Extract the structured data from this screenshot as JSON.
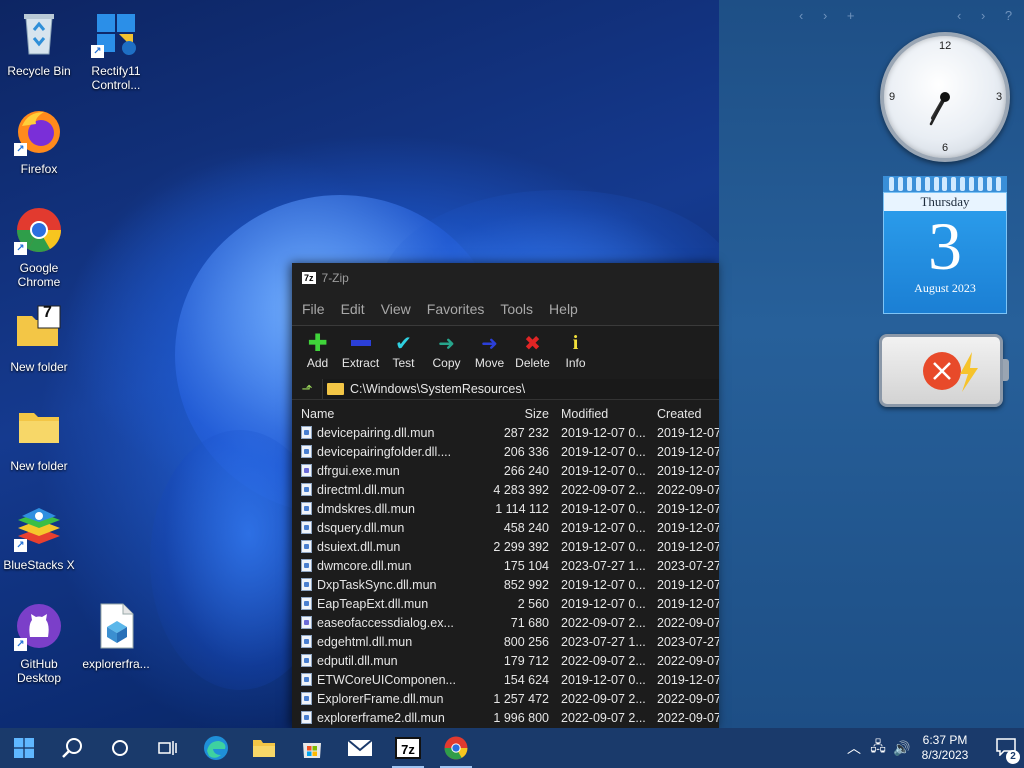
{
  "desktop": {
    "icons": [
      {
        "label": "Recycle Bin",
        "icon": "recycle-bin-icon"
      },
      {
        "label": "Rectify11 Control...",
        "icon": "rectify11-control-icon"
      },
      {
        "label": "Firefox",
        "icon": "firefox-icon"
      },
      {
        "label": "Google Chrome",
        "icon": "chrome-icon"
      },
      {
        "label": "New folder",
        "icon": "folder-7zip-icon",
        "badge": "7"
      },
      {
        "label": "New folder",
        "icon": "folder-icon"
      },
      {
        "label": "BlueStacks X",
        "icon": "bluestacks-icon"
      },
      {
        "label": "GitHub Desktop",
        "icon": "github-desktop-icon"
      },
      {
        "label": "explorerfra...",
        "icon": "dll-file-icon"
      }
    ]
  },
  "gadgets": {
    "clock": {
      "numbers": [
        "12",
        "3",
        "6",
        "9"
      ]
    },
    "calendar": {
      "weekday": "Thursday",
      "day": "3",
      "month_year": "August 2023"
    },
    "battery": {
      "status_icon": "battery-error-icon"
    }
  },
  "zip": {
    "title": "7-Zip",
    "logo": "7z",
    "menu": [
      "File",
      "Edit",
      "View",
      "Favorites",
      "Tools",
      "Help"
    ],
    "toolbar": [
      {
        "label": "Add",
        "icon": "add-icon",
        "glyph": "✚",
        "color": "#3fd43a"
      },
      {
        "label": "Extract",
        "icon": "extract-icon",
        "glyph": "▬",
        "color": "#2b3fd8"
      },
      {
        "label": "Test",
        "icon": "test-icon",
        "glyph": "✔",
        "color": "#2fd0e0"
      },
      {
        "label": "Copy",
        "icon": "copy-icon",
        "glyph": "➜",
        "color": "#27a58c"
      },
      {
        "label": "Move",
        "icon": "move-icon",
        "glyph": "➜",
        "color": "#2b3fd8"
      },
      {
        "label": "Delete",
        "icon": "delete-icon",
        "glyph": "✖",
        "color": "#e02525"
      },
      {
        "label": "Info",
        "icon": "info-icon",
        "glyph": "i",
        "color": "#f2e03a"
      }
    ],
    "path": "C:\\Windows\\SystemResources\\",
    "columns": {
      "name": "Name",
      "size": "Size",
      "modified": "Modified",
      "created": "Created"
    },
    "files": [
      {
        "name": "devicepairing.dll.mun",
        "size": "287 232",
        "modified": "2019-12-07 0...",
        "created": "2019-12-07"
      },
      {
        "name": "devicepairingfolder.dll....",
        "size": "206 336",
        "modified": "2019-12-07 0...",
        "created": "2019-12-07"
      },
      {
        "name": "dfrgui.exe.mun",
        "size": "266 240",
        "modified": "2019-12-07 0...",
        "created": "2019-12-07",
        "type": "exe"
      },
      {
        "name": "directml.dll.mun",
        "size": "4 283 392",
        "modified": "2022-09-07 2...",
        "created": "2022-09-07"
      },
      {
        "name": "dmdskres.dll.mun",
        "size": "1 114 112",
        "modified": "2019-12-07 0...",
        "created": "2019-12-07"
      },
      {
        "name": "dsquery.dll.mun",
        "size": "458 240",
        "modified": "2019-12-07 0...",
        "created": "2019-12-07"
      },
      {
        "name": "dsuiext.dll.mun",
        "size": "2 299 392",
        "modified": "2019-12-07 0...",
        "created": "2019-12-07"
      },
      {
        "name": "dwmcore.dll.mun",
        "size": "175 104",
        "modified": "2023-07-27 1...",
        "created": "2023-07-27"
      },
      {
        "name": "DxpTaskSync.dll.mun",
        "size": "852 992",
        "modified": "2019-12-07 0...",
        "created": "2019-12-07"
      },
      {
        "name": "EapTeapExt.dll.mun",
        "size": "2 560",
        "modified": "2019-12-07 0...",
        "created": "2019-12-07"
      },
      {
        "name": "easeofaccessdialog.ex...",
        "size": "71 680",
        "modified": "2022-09-07 2...",
        "created": "2022-09-07",
        "type": "exe"
      },
      {
        "name": "edgehtml.dll.mun",
        "size": "800 256",
        "modified": "2023-07-27 1...",
        "created": "2023-07-27"
      },
      {
        "name": "edputil.dll.mun",
        "size": "179 712",
        "modified": "2022-09-07 2...",
        "created": "2022-09-07"
      },
      {
        "name": "ETWCoreUIComponen...",
        "size": "154 624",
        "modified": "2019-12-07 0...",
        "created": "2019-12-07"
      },
      {
        "name": "ExplorerFrame.dll.mun",
        "size": "1 257 472",
        "modified": "2022-09-07 2...",
        "created": "2022-09-07"
      },
      {
        "name": "explorerframe2.dll.mun",
        "size": "1 996 800",
        "modified": "2022-09-07 2...",
        "created": "2022-09-07"
      }
    ]
  },
  "taskbar": {
    "items": [
      {
        "name": "start-button",
        "icon": "windows-logo-icon"
      },
      {
        "name": "search-button",
        "icon": "search-icon"
      },
      {
        "name": "cortana-button",
        "icon": "cortana-icon"
      },
      {
        "name": "task-view-button",
        "icon": "task-view-icon"
      },
      {
        "name": "edge-button",
        "icon": "edge-icon"
      },
      {
        "name": "file-explorer-button",
        "icon": "file-explorer-icon"
      },
      {
        "name": "store-button",
        "icon": "store-icon"
      },
      {
        "name": "mail-button",
        "icon": "mail-icon"
      },
      {
        "name": "7zip-button",
        "icon": "7zip-icon",
        "active": true
      },
      {
        "name": "chrome-taskbar-button",
        "icon": "chrome-icon",
        "active": true
      }
    ],
    "tray": {
      "time": "6:37 PM",
      "date": "8/3/2023",
      "notifications": "2"
    }
  }
}
